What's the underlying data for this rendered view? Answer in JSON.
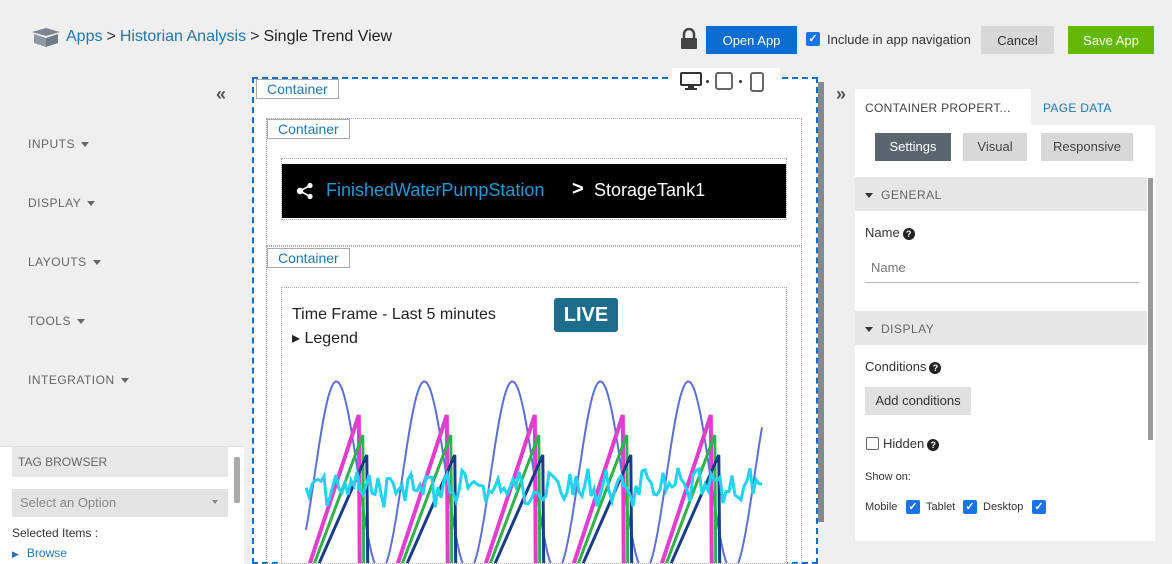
{
  "breadcrumb": {
    "apps": "Apps",
    "analysis": "Historian Analysis",
    "view": "Single Trend View",
    "separator": ">"
  },
  "toolbar": {
    "open_app": "Open App",
    "include_nav_label": "Include in app navigation",
    "include_nav_checked": true,
    "cancel": "Cancel",
    "save": "Save App",
    "colors": {
      "open": "#0a6dcf",
      "save": "#63b800"
    }
  },
  "palette": {
    "collapse": "«",
    "items": [
      {
        "label": "INPUTS"
      },
      {
        "label": "DISPLAY"
      },
      {
        "label": "LAYOUTS"
      },
      {
        "label": "TOOLS"
      },
      {
        "label": "INTEGRATION"
      }
    ]
  },
  "tag_browser": {
    "title": "TAG BROWSER",
    "select_placeholder": "Select an Option",
    "selected_items": "Selected Items :",
    "browse": "Browse"
  },
  "canvas": {
    "container_label": "Container",
    "sub1_label": "Container",
    "sub2_label": "Container",
    "devices": [
      "desktop-icon",
      "tablet-icon",
      "mobile-icon"
    ],
    "header": {
      "station": "FinishedWaterPumpStation",
      "chevron": ">",
      "tank": "StorageTank1"
    },
    "trend": {
      "timeframe": "Time Frame -  Last 5 minutes",
      "legend": "▸ Legend",
      "live": "LIVE"
    }
  },
  "chart_data": {
    "type": "line",
    "title": "",
    "xlabel": "",
    "ylabel": "",
    "series": [
      {
        "color": "#5b6fd6",
        "shape": "sine"
      },
      {
        "color": "#e33ccf",
        "shape": "sawtooth"
      },
      {
        "color": "#2fb24a",
        "shape": "sawtooth"
      },
      {
        "color": "#1a3a8a",
        "shape": "sawtooth"
      },
      {
        "color": "#22d3f0",
        "shape": "noise"
      }
    ]
  },
  "right_panel": {
    "collapse": "»",
    "tabs": [
      "CONTAINER PROPERT...",
      "PAGE DATA"
    ],
    "segments": [
      "Settings",
      "Visual",
      "Responsive"
    ],
    "general_head": "GENERAL",
    "name_label": "Name",
    "name_placeholder": "Name",
    "display_head": "DISPLAY",
    "conditions_label": "Conditions",
    "add_conditions": "Add conditions",
    "hidden_label": "Hidden",
    "show_on_label": "Show on:",
    "show_on": [
      {
        "label": "Mobile",
        "checked": true
      },
      {
        "label": "Tablet",
        "checked": true
      },
      {
        "label": "Desktop",
        "checked": true
      }
    ]
  }
}
